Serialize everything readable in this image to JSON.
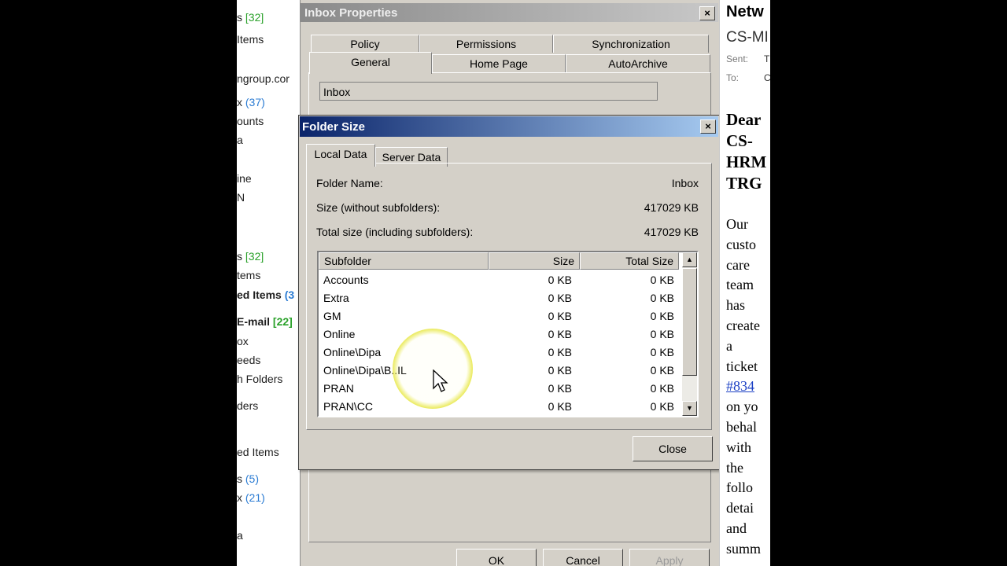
{
  "folder_pane": {
    "items": [
      {
        "text": "s ",
        "count": "[32]",
        "count_color": "green"
      },
      {
        "text": "Items",
        "count": ""
      },
      {
        "text": "ngroup.cor",
        "count": ""
      },
      {
        "text": "x ",
        "count": "(37)",
        "count_color": "blue"
      },
      {
        "text": "ounts",
        "count": ""
      },
      {
        "text": "a",
        "count": ""
      },
      {
        "text": "ine",
        "count": ""
      },
      {
        "text": "N",
        "count": ""
      },
      {
        "text": "s ",
        "count": "[32]",
        "count_color": "green"
      },
      {
        "text": "tems",
        "count": ""
      },
      {
        "text": "ed Items ",
        "count": "(3",
        "count_color": "blue",
        "bold": true
      },
      {
        "text": "E-mail ",
        "count": "[22]",
        "count_color": "green",
        "bold": true
      },
      {
        "text": "ox",
        "count": ""
      },
      {
        "text": "eeds",
        "count": ""
      },
      {
        "text": "h Folders",
        "count": ""
      },
      {
        "text": "ders",
        "count": ""
      },
      {
        "text": "ed Items",
        "count": ""
      },
      {
        "text": "s ",
        "count": "(5)",
        "count_color": "blue"
      },
      {
        "text": "x ",
        "count": "(21)",
        "count_color": "blue"
      },
      {
        "text": "a",
        "count": ""
      }
    ]
  },
  "props_window": {
    "title": "Inbox Properties",
    "tabs_row1": [
      "Policy",
      "Permissions",
      "Synchronization"
    ],
    "tabs_row2": [
      "General",
      "Home Page",
      "AutoArchive"
    ],
    "name_value": "Inbox",
    "buttons": {
      "ok": "OK",
      "cancel": "Cancel",
      "apply": "Apply"
    }
  },
  "folder_size": {
    "title": "Folder Size",
    "tabs": [
      "Local Data",
      "Server Data"
    ],
    "folder_name_label": "Folder Name:",
    "folder_name_value": "Inbox",
    "size_label": "Size (without subfolders):",
    "size_value": "417029 KB",
    "total_label": "Total size (including subfolders):",
    "total_value": "417029 KB",
    "columns": [
      "Subfolder",
      "Size",
      "Total Size"
    ],
    "rows": [
      {
        "name": "Accounts",
        "size": "0 KB",
        "total": "0 KB"
      },
      {
        "name": "Extra",
        "size": "0 KB",
        "total": "0 KB"
      },
      {
        "name": "GM",
        "size": "0 KB",
        "total": "0 KB"
      },
      {
        "name": "Online",
        "size": "0 KB",
        "total": "0 KB"
      },
      {
        "name": "Online\\Dipa",
        "size": "0 KB",
        "total": "0 KB"
      },
      {
        "name": "Online\\Dipa\\B..IL",
        "size": "0 KB",
        "total": "0 KB"
      },
      {
        "name": "PRAN",
        "size": "0 KB",
        "total": "0 KB"
      },
      {
        "name": "PRAN\\CC",
        "size": "0 KB",
        "total": "0 KB"
      }
    ],
    "close_label": "Close"
  },
  "reading_pane": {
    "heading": "Netw",
    "subject": "CS-MI",
    "sent_label": "Sent:",
    "sent_value": "T",
    "to_label": "To:",
    "to_value": "C",
    "greeting": [
      "Dear",
      "CS-",
      "HRM",
      "TRG"
    ],
    "body": [
      "Our",
      "custo",
      "care",
      "team",
      "has",
      "create",
      "a",
      "ticket",
      "#834",
      "on yo",
      "behal",
      "with",
      "the",
      "follo",
      "detai",
      "and",
      "summ"
    ]
  },
  "colors": {
    "dialog_bg": "#d4d0c8",
    "active_title": "#0a246a",
    "link": "#1a3fc4",
    "count_blue": "#2a7bd3",
    "count_green": "#2aa12a"
  }
}
